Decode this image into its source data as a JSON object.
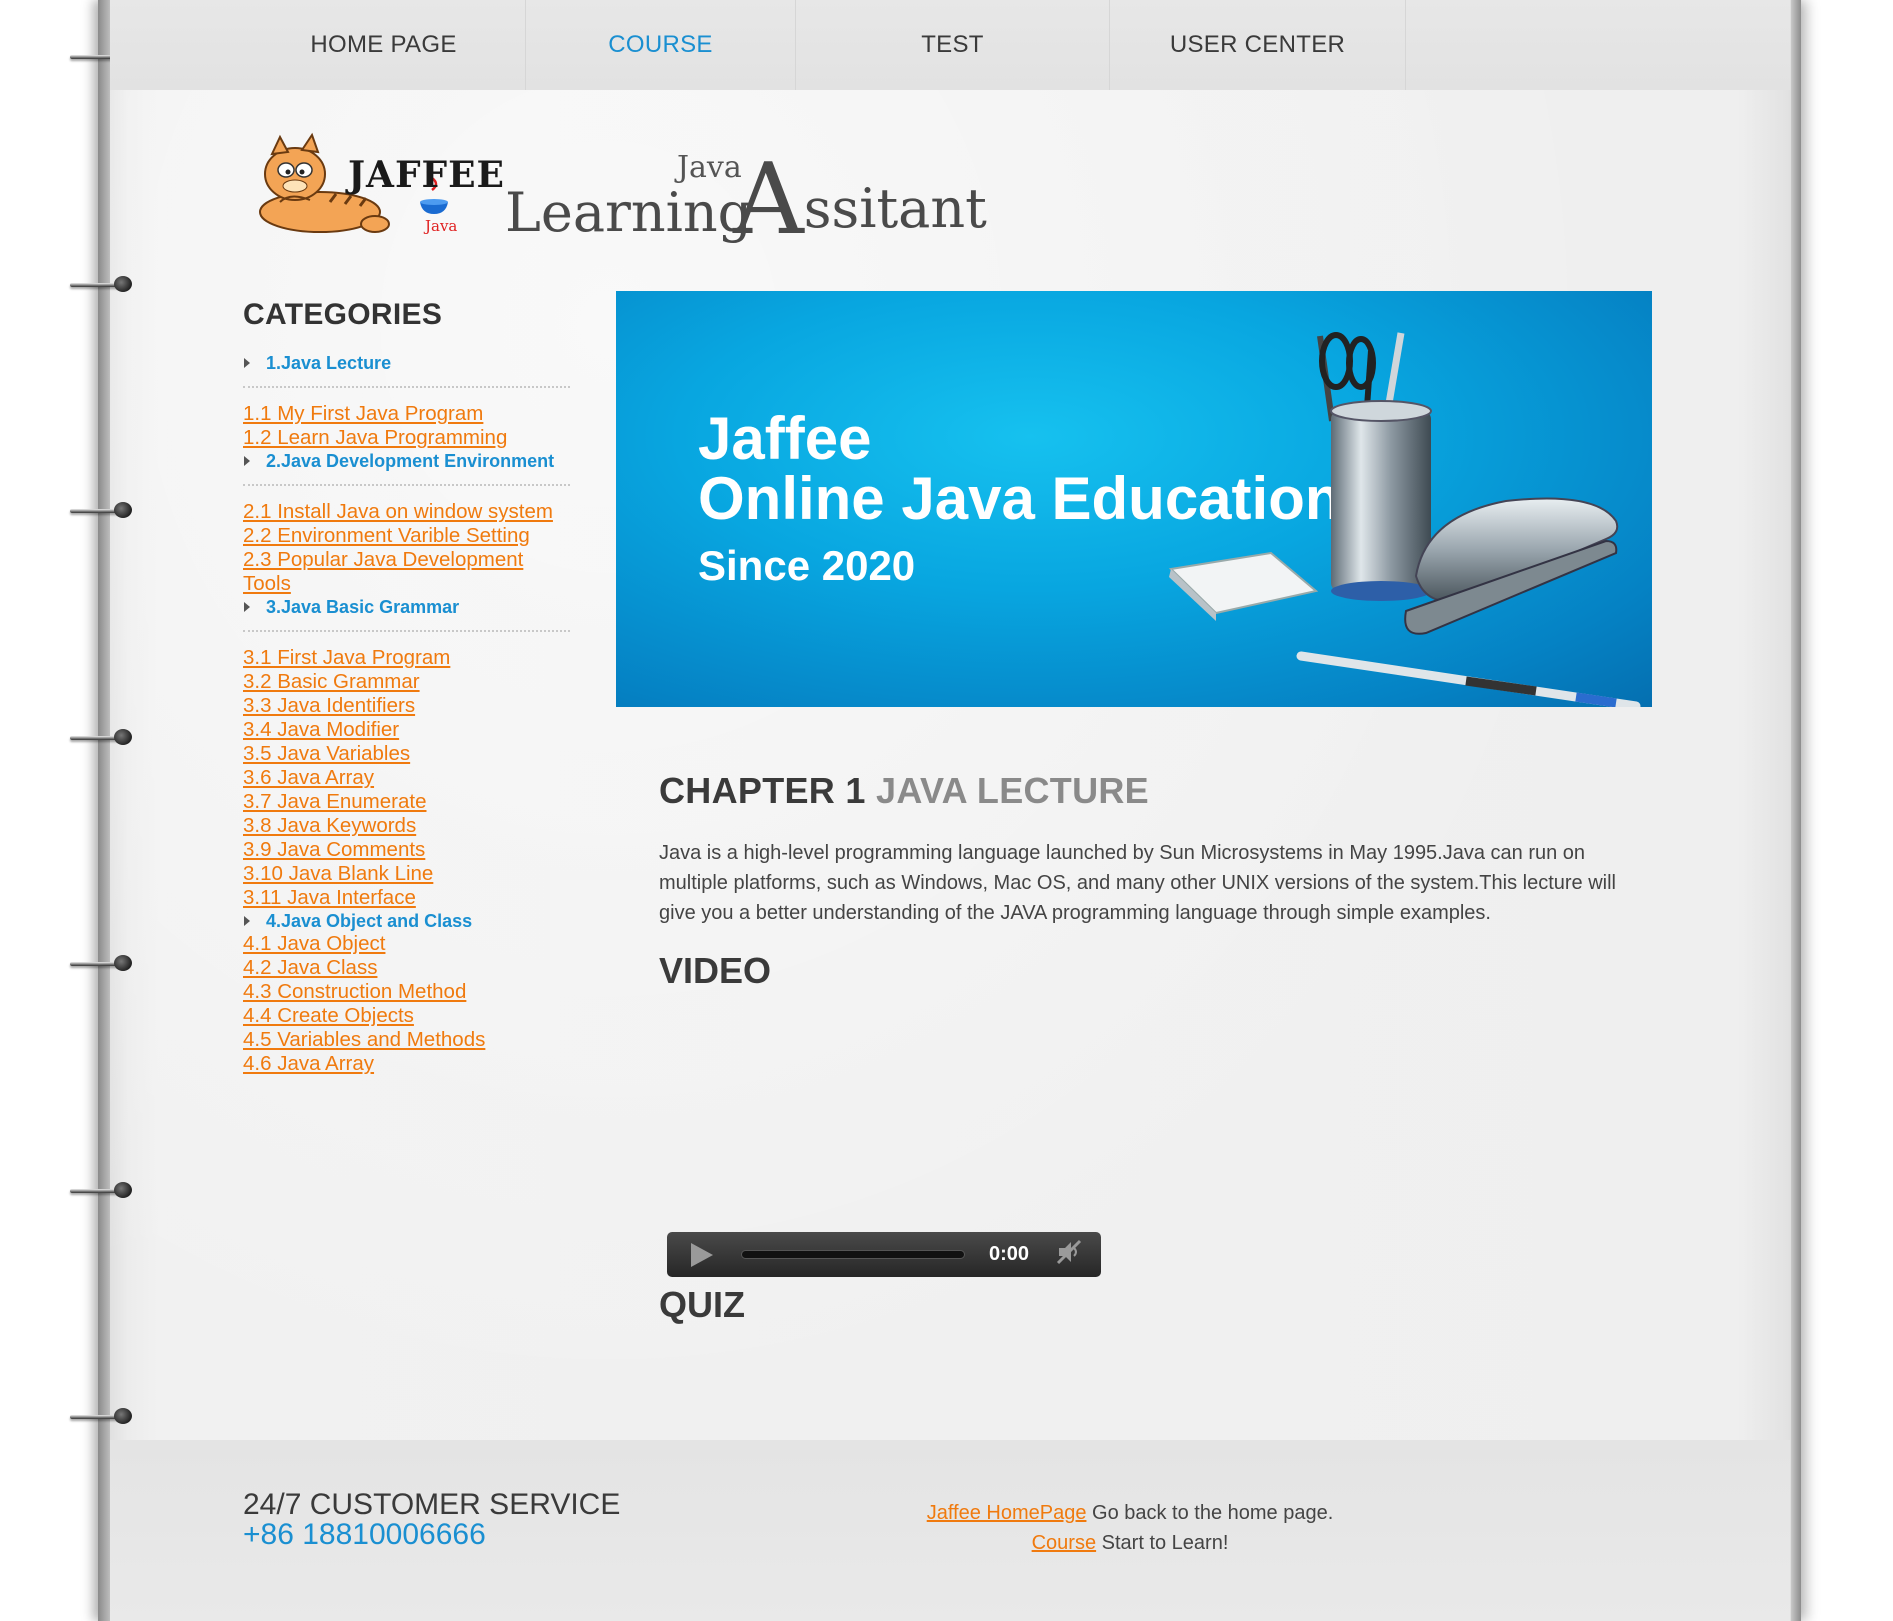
{
  "nav": {
    "items": [
      {
        "label": "HOME PAGE",
        "active": false
      },
      {
        "label": "COURSE",
        "active": true
      },
      {
        "label": "TEST",
        "active": false
      },
      {
        "label": "USER CENTER",
        "active": false
      }
    ]
  },
  "logo": {
    "brand": "JAFFEE",
    "brand_sub": "Java",
    "title_small": "Java",
    "title_learning": "Learning",
    "title_a": "A",
    "title_rest": "ssitant"
  },
  "sidebar": {
    "heading": "CATEGORIES",
    "categories": [
      {
        "title": "1.Java Lecture",
        "lessons": [
          "1.1 My First Java Program",
          "1.2 Learn Java Programming"
        ]
      },
      {
        "title": "2.Java Development Environment",
        "lessons": [
          "2.1 Install Java on window system",
          "2.2 Environment Varible Setting",
          "2.3 Popular Java Development Tools"
        ]
      },
      {
        "title": "3.Java Basic Grammar",
        "lessons": [
          "3.1 First Java Program",
          "3.2 Basic Grammar",
          "3.3 Java Identifiers",
          "3.4 Java Modifier",
          "3.5 Java Variables",
          "3.6 Java Array",
          "3.7 Java Enumerate",
          "3.8 Java Keywords",
          "3.9 Java Comments",
          "3.10 Java Blank Line",
          "3.11 Java Interface"
        ]
      },
      {
        "title": "4.Java Object and Class",
        "lessons": [
          "4.1 Java Object",
          "4.2 Java Class",
          "4.3 Construction Method",
          "4.4 Create Objects",
          "4.5 Variables and Methods",
          "4.6 Java Array"
        ]
      }
    ]
  },
  "banner": {
    "line1": "Jaffee",
    "line2": "Online Java Education",
    "line3": "Since 2020"
  },
  "main": {
    "chapter_label": "CHAPTER 1",
    "chapter_name": "JAVA LECTURE",
    "intro": "Java is a high-level programming language launched by Sun Microsystems in May 1995.Java can run on multiple platforms, such as Windows, Mac OS, and many other UNIX versions of the system.This lecture will give you a better understanding of the JAVA programming language through simple examples.",
    "video_heading": "VIDEO",
    "quiz_heading": "QUIZ",
    "player_time": "0:00"
  },
  "footer": {
    "service_title": "24/7 CUSTOMER SERVICE",
    "service_phone": "+86 18810006666",
    "link1_text": "Jaffee HomePage",
    "link1_desc": " Go back to the home page.",
    "link2_text": "Course",
    "link2_desc": " Start to Learn!"
  },
  "colors": {
    "accent": "#1a8fd1",
    "link": "#f07a0e",
    "banner": "#08a6e0"
  }
}
